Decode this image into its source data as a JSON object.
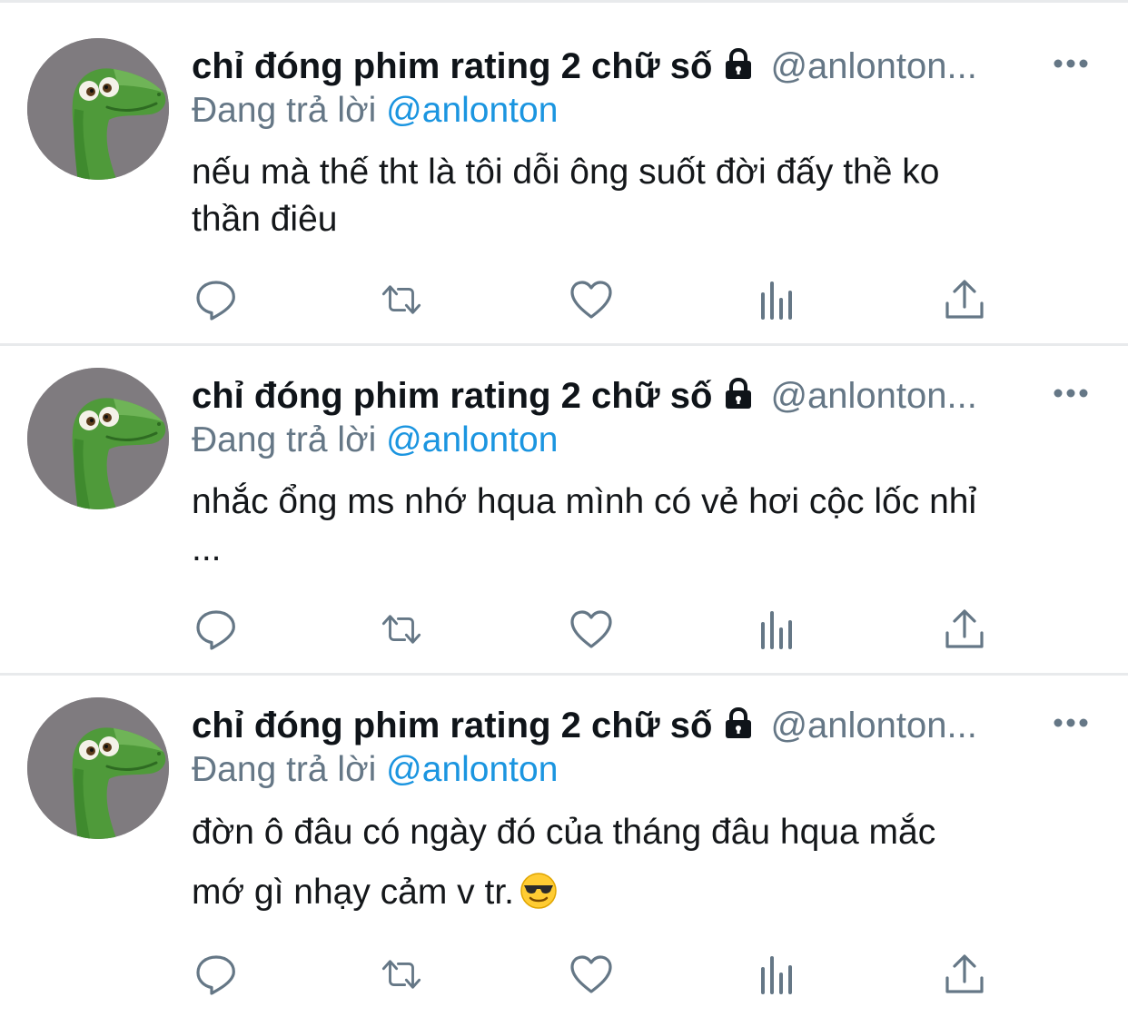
{
  "colors": {
    "name": "#0f1419",
    "secondary": "#657786",
    "mention": "#1b95e0",
    "divider": "#e8eaec",
    "icon": "#657786"
  },
  "icons": {
    "lock": "lock-icon",
    "more": "more-icon",
    "actions": [
      "reply-icon",
      "retweet-icon",
      "like-icon",
      "analytics-icon",
      "share-icon"
    ]
  },
  "tweets": [
    {
      "display_name": "chỉ đóng phim rating 2 chữ số",
      "handle": "@anlonton...",
      "reply_prefix": "Đang trả lời",
      "reply_mention": "@anlonton",
      "body_lines": [
        "nếu mà thế tht là tôi dỗi ông suốt đời đấy thề ko",
        "thần điêu"
      ]
    },
    {
      "display_name": "chỉ đóng phim rating 2 chữ số",
      "handle": "@anlonton...",
      "reply_prefix": "Đang trả lời",
      "reply_mention": "@anlonton",
      "body_lines": [
        "nhắc ổng ms nhớ hqua mình có vẻ hơi cộc lốc nhỉ",
        "..."
      ]
    },
    {
      "display_name": "chỉ đóng phim rating 2 chữ số",
      "handle": "@anlonton...",
      "reply_prefix": "Đang trả lời",
      "reply_mention": "@anlonton",
      "body_lines": [
        "đờn ô đâu có ngày đó của tháng đâu hqua mắc",
        "mớ gì nhạy cảm v tr."
      ],
      "emoji": "smiling-face-with-sunglasses"
    }
  ]
}
